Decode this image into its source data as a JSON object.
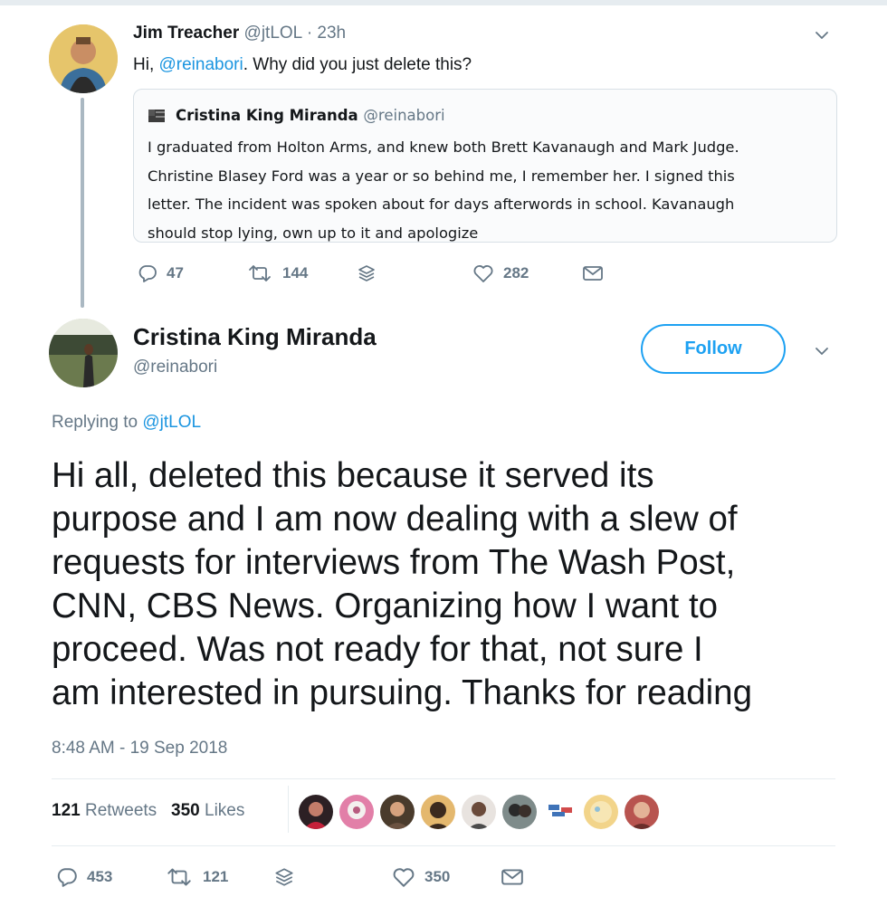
{
  "parent": {
    "name": "Jim Treacher",
    "handle": "@jtLOL",
    "separator": "·",
    "time": "23h",
    "text_before": "Hi, ",
    "mention": "@reinabori",
    "text_after": ". Why did you just delete this?",
    "quote": {
      "name": "Cristina King Miranda",
      "handle": "@reinabori",
      "lines": [
        "I graduated from Holton Arms, and knew both Brett Kavanaugh and Mark Judge.",
        "Christine Blasey Ford was a year or so behind me, I remember her. I signed this",
        "letter. The incident was spoken about for days afterwords in school. Kavanaugh",
        "should stop lying, own up to it and apologize"
      ]
    },
    "actions": {
      "replies": "47",
      "retweets": "144",
      "likes": "282"
    }
  },
  "tweet": {
    "name": "Cristina King Miranda",
    "handle": "@reinabori",
    "follow_label": "Follow",
    "replying_label": "Replying to ",
    "replying_to": "@jtLOL",
    "lines": [
      "Hi all, deleted this because it served its",
      "purpose and I am now dealing with a slew of",
      "requests for interviews from The Wash Post,",
      "CNN, CBS News. Organizing how I want to",
      "proceed. Was not ready for that, not sure I",
      "am interested in pursuing. Thanks for reading"
    ],
    "timestamp": "8:48 AM - 19 Sep 2018",
    "retweet_count": "121",
    "retweets_label": "Retweets",
    "like_count": "350",
    "likes_label": "Likes",
    "actions": {
      "replies": "453",
      "retweets": "121",
      "likes": "350"
    }
  },
  "colors": {
    "link": "#1b95e0",
    "follow": "#1da1f2",
    "secondary_text": "#657786",
    "thread_line": "#aab8c2"
  }
}
